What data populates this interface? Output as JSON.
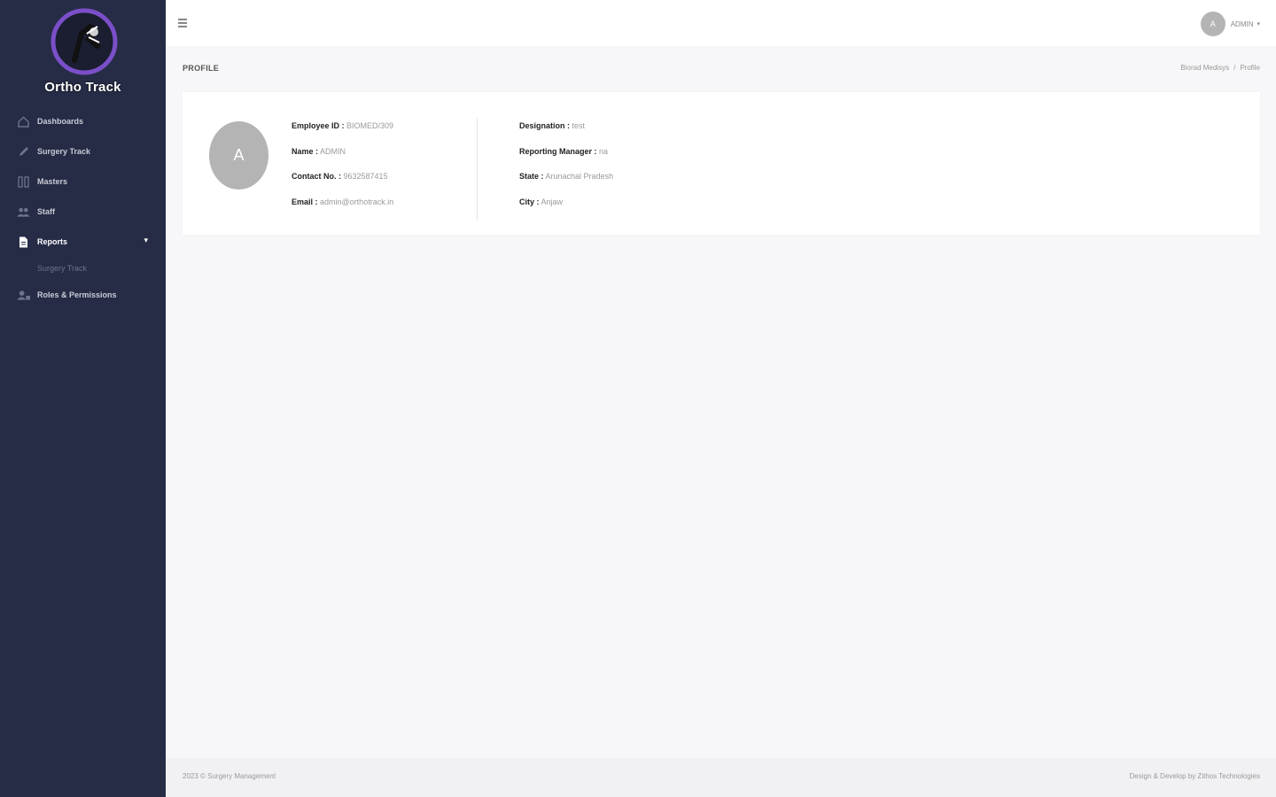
{
  "brand": {
    "name": "Ortho Track"
  },
  "sidebar": {
    "items": [
      {
        "label": "Dashboards",
        "icon": "home-icon"
      },
      {
        "label": "Surgery Track",
        "icon": "pencil-icon"
      },
      {
        "label": "Masters",
        "icon": "grid-icon"
      },
      {
        "label": "Staff",
        "icon": "users-icon"
      },
      {
        "label": "Reports",
        "icon": "document-icon",
        "expanded": true,
        "sub": [
          {
            "label": "Surgery Track"
          }
        ]
      },
      {
        "label": "Roles & Permissions",
        "icon": "user-lock-icon"
      }
    ]
  },
  "topbar": {
    "avatar_initial": "A",
    "user_name": "ADMIN"
  },
  "page": {
    "title": "PROFILE",
    "breadcrumb": [
      "Biorad Medisys",
      "Profile"
    ]
  },
  "profile": {
    "avatar_initial": "A",
    "left": [
      {
        "label": "Employee ID :",
        "value": "BIOMED/309"
      },
      {
        "label": "Name :",
        "value": "ADMIN"
      },
      {
        "label": "Contact No. :",
        "value": "9632587415"
      },
      {
        "label": "Email :",
        "value": "admin@orthotrack.in"
      }
    ],
    "right": [
      {
        "label": "Designation :",
        "value": "test"
      },
      {
        "label": "Reporting Manager :",
        "value": "na"
      },
      {
        "label": "State :",
        "value": "Arunachal Pradesh"
      },
      {
        "label": "City :",
        "value": "Anjaw"
      }
    ]
  },
  "footer": {
    "left": "2023 © Surgery Management",
    "right": "Design & Develop by Zithos Technologies"
  },
  "colors": {
    "sidebar_bg": "#262c46",
    "accent": "#7b4fc9",
    "avatar_bg": "#b4b4b4"
  }
}
